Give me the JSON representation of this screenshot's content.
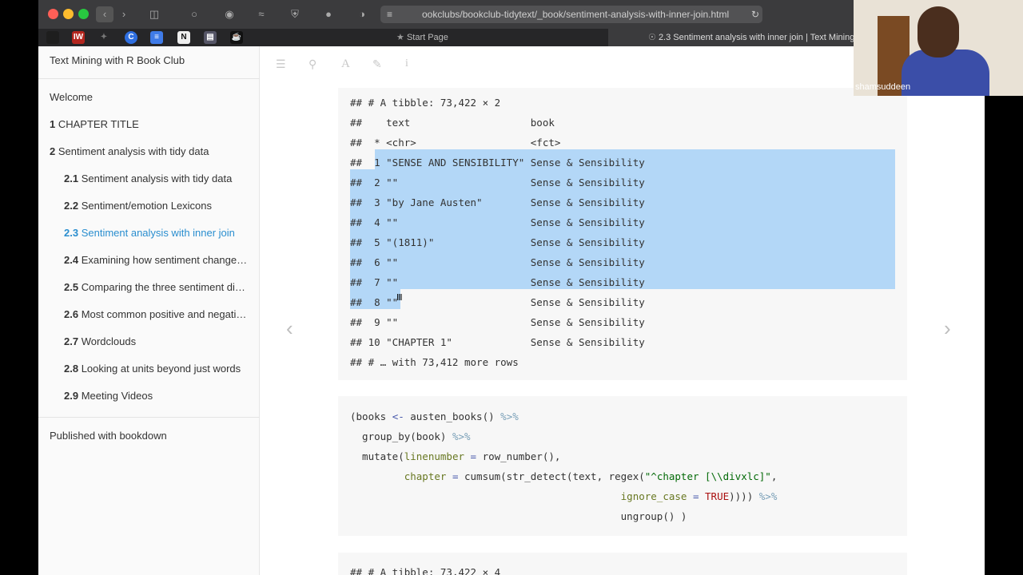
{
  "browser": {
    "url": "ookclubs/bookclub-tidytext/_book/sentiment-analysis-with-inner-join.html",
    "tabs": [
      {
        "label": "Start Page"
      },
      {
        "label": "2.3 Sentiment analysis with inner join | Text Mining"
      }
    ],
    "bookmarks": [
      "IW",
      "C",
      "N"
    ]
  },
  "sidebar": {
    "title": "Text Mining with R Book Club",
    "items": [
      {
        "num": "",
        "label": "Welcome"
      },
      {
        "num": "1",
        "label": "CHAPTER TITLE"
      },
      {
        "num": "2",
        "label": "Sentiment analysis with tidy data"
      },
      {
        "num": "2.1",
        "label": "Sentiment analysis with tidy data"
      },
      {
        "num": "2.2",
        "label": "Sentiment/emotion Lexicons"
      },
      {
        "num": "2.3",
        "label": "Sentiment analysis with inner join"
      },
      {
        "num": "2.4",
        "label": "Examining how sentiment changes across each novel"
      },
      {
        "num": "2.5",
        "label": "Comparing the three sentiment dictionaries"
      },
      {
        "num": "2.6",
        "label": "Most common positive and negative words"
      },
      {
        "num": "2.7",
        "label": "Wordclouds"
      },
      {
        "num": "2.8",
        "label": "Looking at units beyond just words"
      },
      {
        "num": "2.9",
        "label": "Meeting Videos"
      }
    ],
    "footer": "Published with bookdown"
  },
  "output1": {
    "lines": [
      "## # A tibble: 73,422 × 2",
      "##    text                    book",
      "##  * <chr>                   <fct>",
      "##  1 \"SENSE AND SENSIBILITY\" Sense & Sensibility",
      "##  2 \"\"                      Sense & Sensibility",
      "##  3 \"by Jane Austen\"        Sense & Sensibility",
      "##  4 \"\"                      Sense & Sensibility",
      "##  5 \"(1811)\"                Sense & Sensibility",
      "##  6 \"\"                      Sense & Sensibility",
      "##  7 \"\"                      Sense & Sensibility",
      "##  8 \"\"                      Sense & Sensibility",
      "##  9 \"\"                      Sense & Sensibility",
      "## 10 \"CHAPTER 1\"             Sense & Sensibility",
      "## # … with 73,412 more rows"
    ]
  },
  "code": {
    "l1_a": "(books ",
    "l1_op": "<-",
    "l1_b": " austen_books() ",
    "l1_pipe": "%>%",
    "l2_a": "  group_by(book) ",
    "l2_pipe": "%>%",
    "l3_a": "  mutate(",
    "l3_arg": "linenumber",
    "l3_eq": " = ",
    "l3_b": "row_number(),",
    "l4_arg": "         chapter",
    "l4_eq": " = ",
    "l4_b": "cumsum(str_detect(text, regex(",
    "l4_str": "\"^chapter [\\\\divxlc]\"",
    "l4_c": ",",
    "l5_arg": "                                             ignore_case",
    "l5_eq": " = ",
    "l5_kw": "TRUE",
    "l5_b": ")))) ",
    "l5_pipe": "%>%",
    "l6_a": "                                             ungroup() )"
  },
  "output2": {
    "first_line": "## # A tibble: 73,422 × 4"
  },
  "webcam": {
    "name": "shamsuddeen"
  }
}
